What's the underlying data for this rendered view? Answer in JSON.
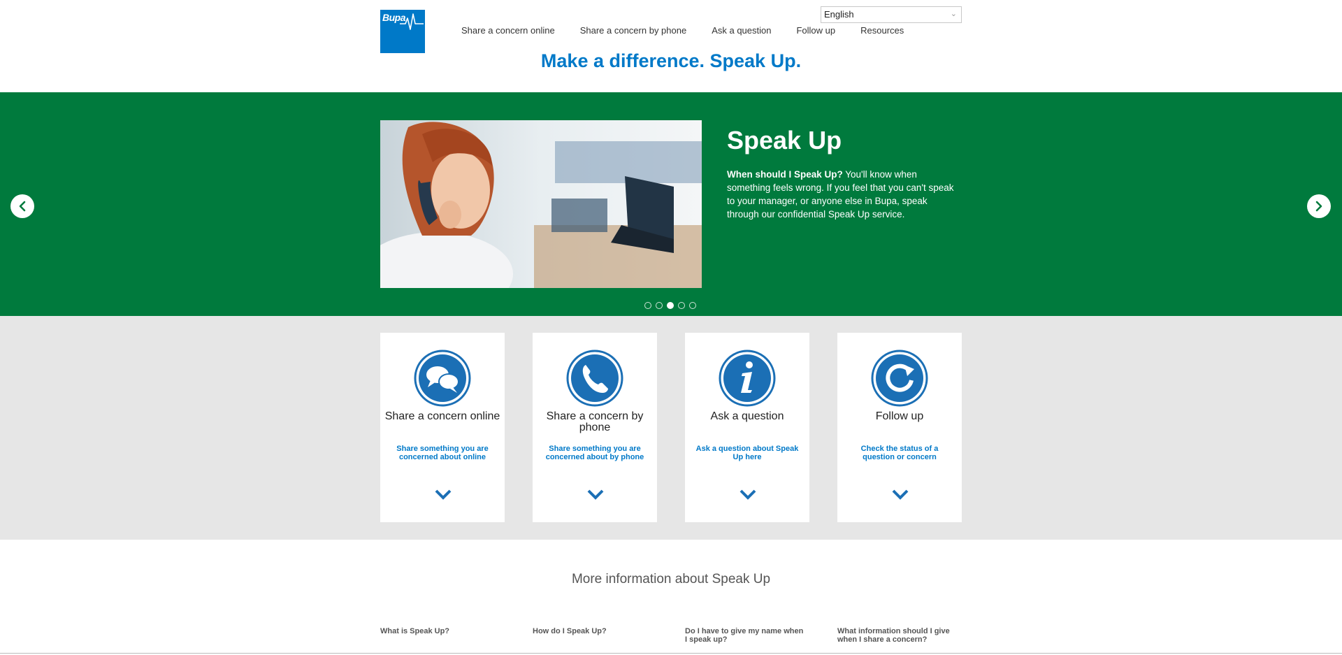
{
  "brand": {
    "logo_text": "Bupa",
    "primary_color": "#0079c8",
    "green": "#007a3d"
  },
  "language": {
    "selected": "English"
  },
  "nav": {
    "items": [
      {
        "label": "Share a concern online"
      },
      {
        "label": "Share a concern by phone"
      },
      {
        "label": "Ask a question"
      },
      {
        "label": "Follow up"
      },
      {
        "label": "Resources"
      }
    ]
  },
  "tagline": "Make a difference. Speak Up.",
  "carousel": {
    "title": "Speak Up",
    "text_bold": "When should I Speak Up?",
    "text_rest": " You'll know when something feels wrong. If you feel that you can't speak to your manager, or anyone else in Bupa, speak through our confidential Speak Up service.",
    "dots": 5,
    "active_dot": 3
  },
  "cards": [
    {
      "title": "Share a concern online",
      "desc": "Share something you are concerned about online",
      "icon": "speech-bubbles-icon"
    },
    {
      "title": "Share a concern by phone",
      "desc": "Share something you are concerned about by phone",
      "icon": "phone-icon"
    },
    {
      "title": "Ask a question",
      "desc": "Ask a question about Speak Up here",
      "icon": "info-icon"
    },
    {
      "title": "Follow up",
      "desc": "Check the status of a question or concern",
      "icon": "refresh-icon"
    }
  ],
  "more_info": {
    "title": "More information about Speak Up",
    "links": [
      {
        "label": "What is Speak Up?"
      },
      {
        "label": "How do I Speak Up?"
      },
      {
        "label": "Do I have to give my name when I speak up?"
      },
      {
        "label": "What information should I give when I share a concern?"
      }
    ]
  }
}
